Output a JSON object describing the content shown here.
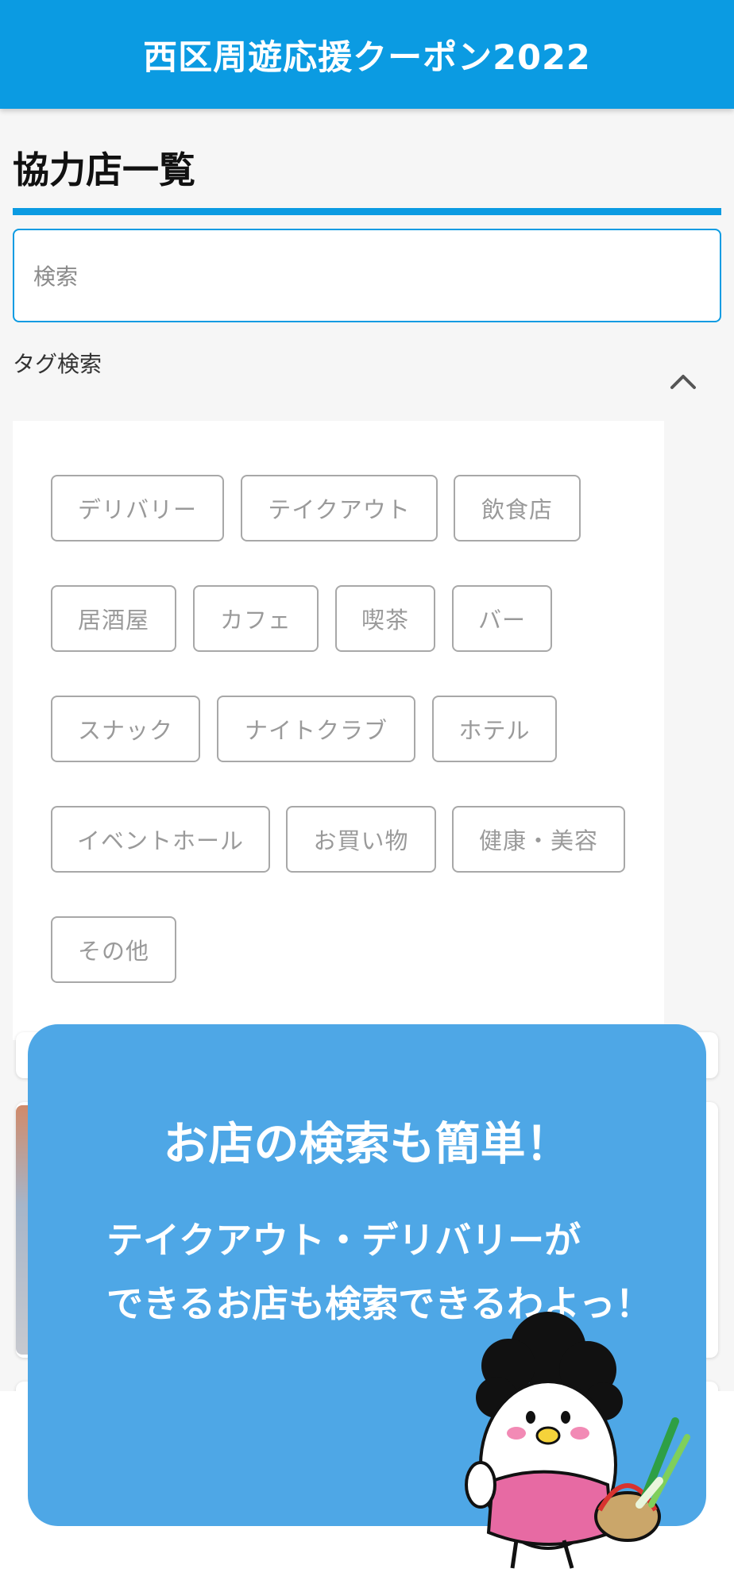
{
  "header": {
    "title": "西区周遊応援クーポン2022"
  },
  "page": {
    "title": "協力店一覧"
  },
  "search": {
    "placeholder": "検索"
  },
  "tag_search": {
    "label": "タグ検索",
    "tags": [
      "デリバリー",
      "テイクアウト",
      "飲食店",
      "居酒屋",
      "カフェ",
      "喫茶",
      "バー",
      "スナック",
      "ナイトクラブ",
      "ホテル",
      "イベントホール",
      "お買い物",
      "健康・美容",
      "その他"
    ]
  },
  "overlay": {
    "heading": "お店の検索も簡単！",
    "line1": "テイクアウト・デリバリーが",
    "line2": "できるお店も検索できるわよっ！"
  },
  "colors": {
    "brand": "#0b9be2",
    "overlay": "#4ea7e6"
  }
}
